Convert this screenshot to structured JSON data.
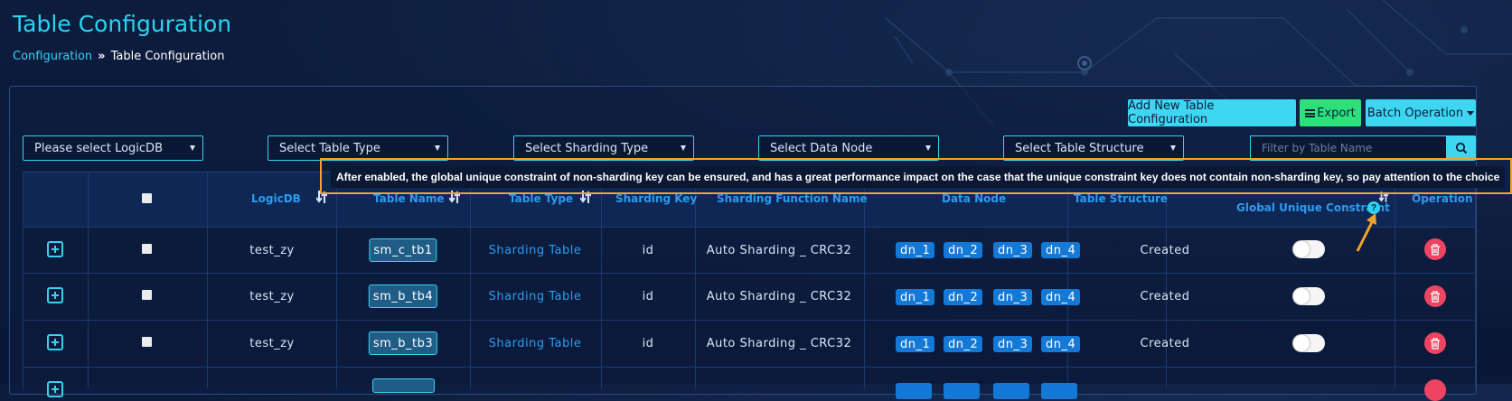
{
  "page": {
    "title": "Table Configuration",
    "breadcrumb": {
      "parent": "Configuration",
      "separator": "»",
      "current": "Table Configuration"
    }
  },
  "toolbar": {
    "add_label": "Add New Table Configuration",
    "export_label": "Export",
    "batch_label": "Batch Operation"
  },
  "filters": {
    "logicdb": "Please select LogicDB",
    "table_type": "Select Table Type",
    "sharding_type": "Select Sharding Type",
    "data_node": "Select Data Node",
    "table_structure": "Select Table Structure",
    "search_placeholder": "Filter by Table Name"
  },
  "table": {
    "headers": {
      "logicdb": "LogicDB",
      "table_name": "Table Name",
      "table_type": "Table Type",
      "sharding_key": "Sharding Key",
      "sharding_function": "Sharding Function Name",
      "data_node": "Data Node",
      "table_structure": "Table Structure",
      "global_unique": "Global Unique Constraint",
      "operation": "Operation"
    },
    "rows": [
      {
        "logicdb": "test_zy",
        "table_name": "sm_c_tb1",
        "table_type": "Sharding Table",
        "sharding_key": "id",
        "sharding_function": "Auto Sharding _ CRC32",
        "data_nodes": [
          "dn_1",
          "dn_2",
          "dn_3",
          "dn_4"
        ],
        "table_structure": "Created",
        "global_unique": false
      },
      {
        "logicdb": "test_zy",
        "table_name": "sm_b_tb4",
        "table_type": "Sharding Table",
        "sharding_key": "id",
        "sharding_function": "Auto Sharding _ CRC32",
        "data_nodes": [
          "dn_1",
          "dn_2",
          "dn_3",
          "dn_4"
        ],
        "table_structure": "Created",
        "global_unique": false
      },
      {
        "logicdb": "test_zy",
        "table_name": "sm_b_tb3",
        "table_type": "Sharding Table",
        "sharding_key": "id",
        "sharding_function": "Auto Sharding _ CRC32",
        "data_nodes": [
          "dn_1",
          "dn_2",
          "dn_3",
          "dn_4"
        ],
        "table_structure": "Created",
        "global_unique": false
      }
    ]
  },
  "tooltip": {
    "text": "After enabled, the global unique constraint of non-sharding key can be ensured, and has a great performance impact on the case that the unique constraint key does not contain non-sharding key, so pay attention to the choice"
  },
  "icons": {
    "export": "menu-icon",
    "search": "search-icon",
    "expand": "plus-square-icon",
    "delete": "trash-icon",
    "help": "question-circle-icon",
    "sort": "sort-icon"
  },
  "colors": {
    "accent": "#3fd6f2",
    "export": "#2ee07a",
    "delete": "#ee4462",
    "data_node": "#1479d6",
    "header_text": "#2b9cf0",
    "highlight": "#f5a12a"
  }
}
